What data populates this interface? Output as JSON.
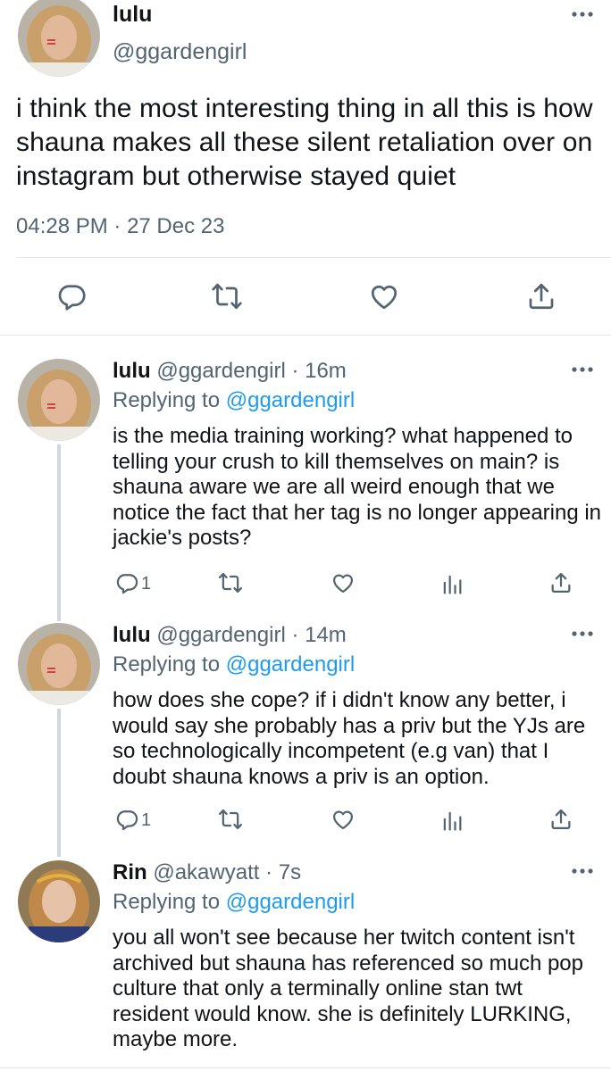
{
  "main_tweet": {
    "name": "lulu",
    "handle": "@ggardengirl",
    "text": "i think the most interesting thing in all this is how shauna makes all these silent retaliation over on instagram but otherwise stayed quiet",
    "time": "04:28 PM",
    "separator": " · ",
    "date": "27 Dec 23",
    "icons": [
      "reply-icon",
      "retweet-icon",
      "like-icon",
      "share-icon"
    ]
  },
  "replies": [
    {
      "name": "lulu",
      "handle": "@ggardengirl",
      "age": "16m",
      "replying_prefix": "Replying to ",
      "replying_to": "@ggardengirl",
      "text": "is the media training working? what happened to telling your crush to kill themselves on main? is shauna aware we are all weird enough that we notice the fact that her tag is no longer appearing in jackie's posts?",
      "reply_count": "1"
    },
    {
      "name": "lulu",
      "handle": "@ggardengirl",
      "age": "14m",
      "replying_prefix": "Replying to ",
      "replying_to": "@ggardengirl",
      "text": "how does she cope? if i didn't know any better, i would say she probably has a priv but the YJs are so technologically incompetent (e.g van) that I doubt shauna knows a priv is an option.",
      "reply_count": "1"
    },
    {
      "name": "Rin",
      "handle": "@akawyatt",
      "age": "7s",
      "replying_prefix": "Replying to ",
      "replying_to": "@ggardengirl",
      "text": "you all won't see because her twitch content isn't archived but shauna has referenced so much pop culture that only a terminally online stan twt  resident would know. she is definitely LURKING, maybe more."
    }
  ],
  "colors": {
    "accent": "#1d9bf0",
    "secondary_text": "#536471",
    "text": "#0f1419",
    "divider": "#e1e8ed"
  }
}
